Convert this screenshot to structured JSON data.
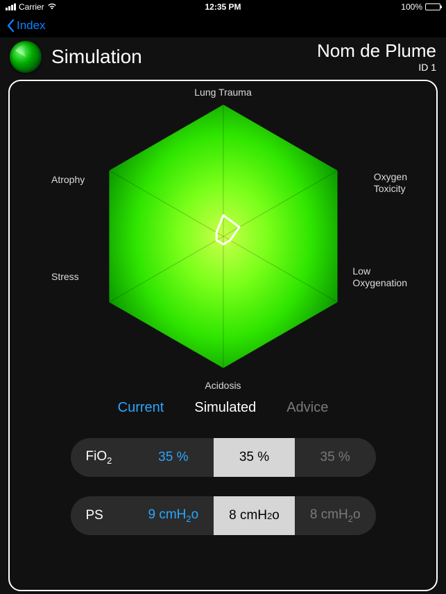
{
  "status": {
    "carrier": "Carrier",
    "time": "12:35 PM",
    "battery": "100%"
  },
  "nav": {
    "back_label": "Index"
  },
  "header": {
    "title": "Simulation",
    "patient_name": "Nom de Plume",
    "patient_id": "ID 1"
  },
  "chart_data": {
    "type": "radar",
    "axes": [
      "Lung Trauma",
      "Oxygen Toxicity",
      "Low Oxygenation",
      "Acidosis",
      "Stress",
      "Atrophy"
    ],
    "axis_max": 1.0,
    "series": [
      {
        "name": "Simulated",
        "color": "#ffffff",
        "fill": false,
        "values": [
          0.16,
          0.14,
          0.06,
          0.06,
          0.06,
          0.06
        ]
      }
    ]
  },
  "axis_labels": {
    "top": "Lung Trauma",
    "tr1": "Oxygen",
    "tr2": "Toxicity",
    "br1": "Low",
    "br2": "Oxygenation",
    "bottom": "Acidosis",
    "bl": "Stress",
    "tl": "Atrophy"
  },
  "tabs": {
    "current": "Current",
    "simulated": "Simulated",
    "advice": "Advice"
  },
  "params": [
    {
      "label_html": "FiO<sub>2</sub>",
      "current": "35 %",
      "simulated": "35 %",
      "advice": "35 %"
    },
    {
      "label_html": "PS",
      "current_html": "9 cmH<sub>2</sub>o",
      "simulated_html": "8 cmH<sub>2</sub>o",
      "advice_html": "8 cmH<sub>2</sub>o"
    }
  ]
}
